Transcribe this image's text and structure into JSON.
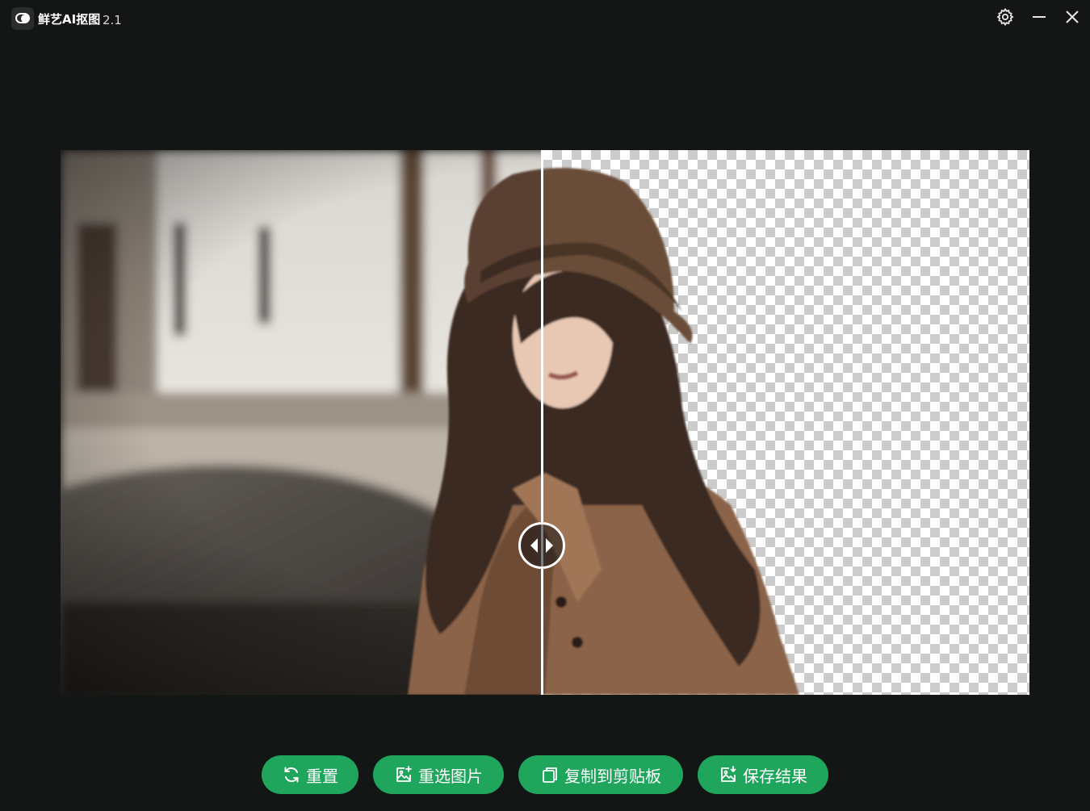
{
  "app": {
    "title": "鲜艺AI抠图",
    "version": "2.1"
  },
  "titlebar": {
    "settings_icon": "gear-icon",
    "minimize_icon": "minimize-icon",
    "close_icon": "close-icon"
  },
  "preview": {
    "left_pane": "original",
    "right_pane": "background-removed",
    "handle_icon": "left-right-arrows-icon"
  },
  "actions": {
    "reset_label": "重置",
    "reselect_label": "重选图片",
    "copy_label": "复制到剪贴板",
    "save_label": "保存结果"
  },
  "colors": {
    "window_bg": "#141515",
    "button_green": "#1fa55c",
    "checker_light": "#ffffff",
    "checker_dark": "#cccccc"
  }
}
